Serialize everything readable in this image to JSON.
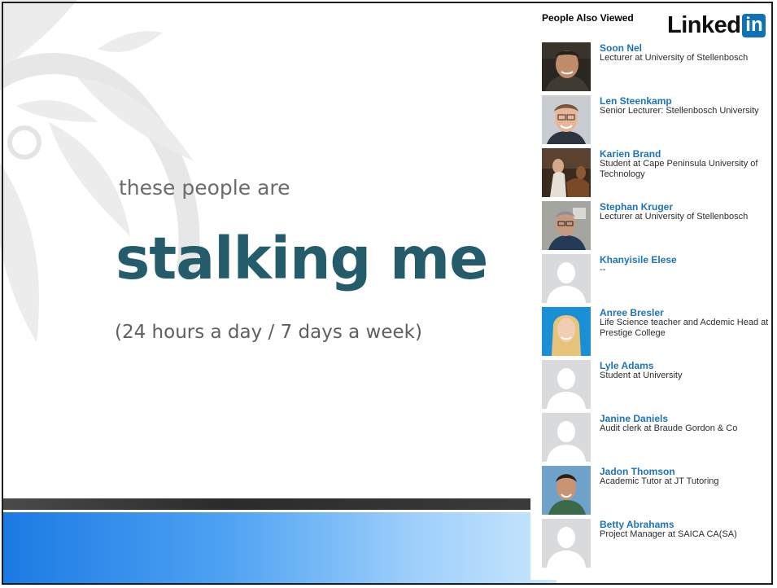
{
  "slide": {
    "kicker": "these people are",
    "headline": "stalking me",
    "subline": "(24 hours a day / 7 days a week)"
  },
  "panel": {
    "title": "People Also Viewed",
    "logo_text": "Linked",
    "logo_in": "in",
    "people": [
      {
        "name": "Soon Nel",
        "title": "Lecturer at University of Stellenbosch"
      },
      {
        "name": "Len Steenkamp",
        "title": "Senior Lecturer: Stellenbosch University"
      },
      {
        "name": "Karien Brand",
        "title": "Student at Cape Peninsula University of Technology"
      },
      {
        "name": "Stephan Kruger",
        "title": "Lecturer at University of Stellenbosch"
      },
      {
        "name": "Khanyisile Elese",
        "title": "--"
      },
      {
        "name": "Anree Bresler",
        "title": "Life Science teacher and Acdemic Head at Prestige College"
      },
      {
        "name": "Lyle Adams",
        "title": "Student at University"
      },
      {
        "name": "Janine Daniels",
        "title": "Audit clerk at Braude Gordon & Co"
      },
      {
        "name": "Jadon Thomson",
        "title": "Academic Tutor at JT Tutoring"
      },
      {
        "name": "Betty Abrahams",
        "title": "Project Manager at SAICA CA(SA)"
      }
    ]
  },
  "colors": {
    "headline": "#255c6c",
    "linkedin_blue": "#0e73b5",
    "name_link": "#1b74b8",
    "band_blue": "#4ea2f2"
  }
}
